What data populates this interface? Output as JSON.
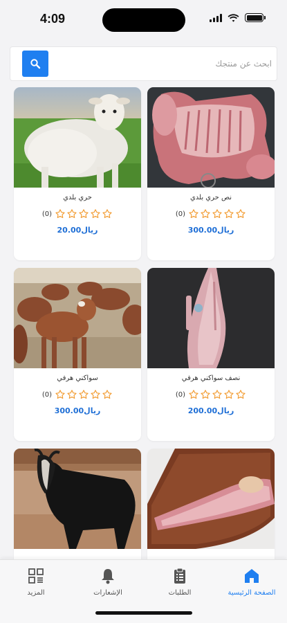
{
  "status_bar": {
    "time": "4:09",
    "icons": [
      "signal-icon",
      "wifi-icon",
      "battery-icon"
    ]
  },
  "search": {
    "placeholder": "ابحث عن منتجك",
    "value": "",
    "button_icon": "search-icon"
  },
  "products": [
    {
      "name": "نص حري بلدي",
      "rating_count": "(0)",
      "stars": 0,
      "price": "300.00ريال",
      "image": "raw-lamb-half-carcass"
    },
    {
      "name": "حري بلدي",
      "rating_count": "(0)",
      "stars": 0,
      "price": "20.00ريال",
      "image": "white-sheep-on-grass"
    },
    {
      "name": "نصف سواكني هرفي",
      "rating_count": "(0)",
      "stars": 0,
      "price": "200.00ريال",
      "image": "hanging-lamb-carcass"
    },
    {
      "name": "سواكني هرفي",
      "rating_count": "(0)",
      "stars": 0,
      "price": "300.00ريال",
      "image": "brown-sheep-flock"
    },
    {
      "name": "",
      "rating_count": "",
      "stars": 0,
      "price": "",
      "image": "lamb-leg-on-board"
    },
    {
      "name": "",
      "rating_count": "",
      "stars": 0,
      "price": "",
      "image": "black-goat"
    }
  ],
  "bottom_nav": [
    {
      "label": "الصفحة الرئيسية",
      "icon": "home-icon",
      "active": true
    },
    {
      "label": "الطلبات",
      "icon": "clipboard-icon",
      "active": false
    },
    {
      "label": "الإشعارات",
      "icon": "bell-icon",
      "active": false
    },
    {
      "label": "المزيد",
      "icon": "grid-icon",
      "active": false
    }
  ],
  "colors": {
    "accent": "#1f7ff0",
    "price": "#1f6fd6",
    "star": "#f29a2e",
    "background": "#f3f3f5"
  }
}
